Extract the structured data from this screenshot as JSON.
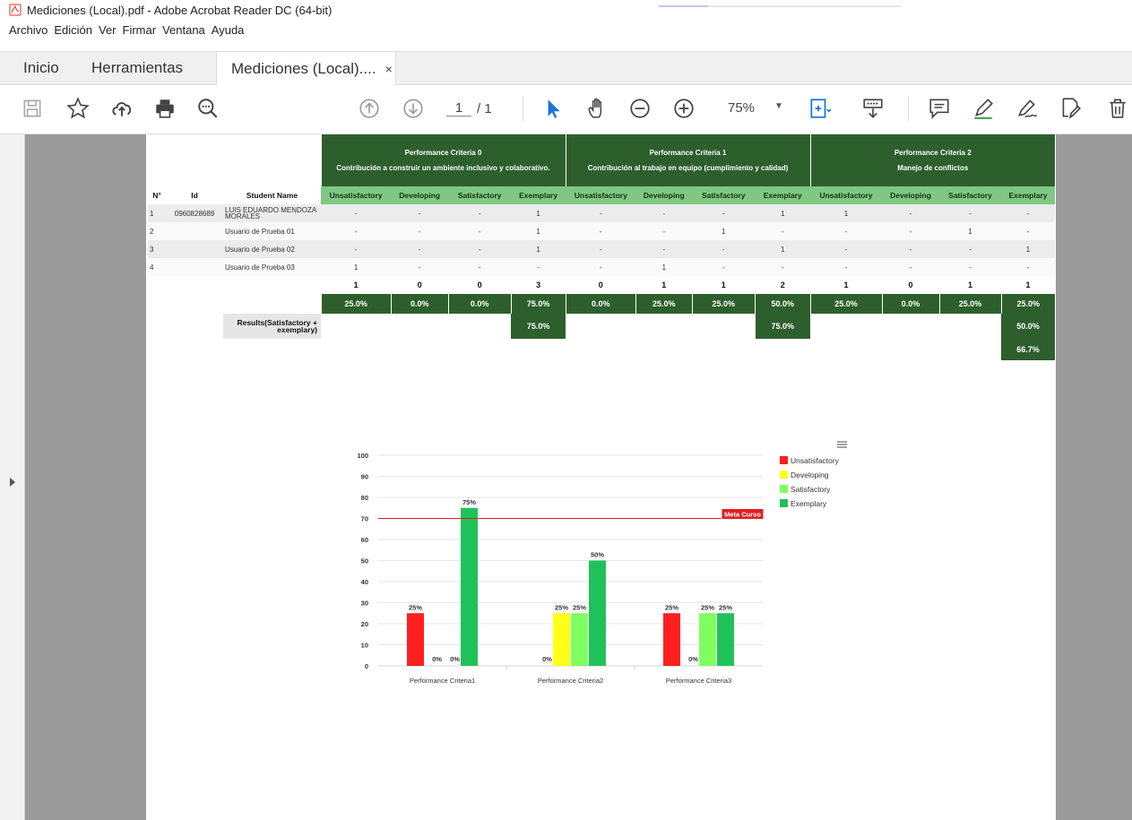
{
  "window": {
    "title": "Mediciones (Local).pdf - Adobe Acrobat Reader DC (64-bit)"
  },
  "menu": [
    "Archivo",
    "Edición",
    "Ver",
    "Firmar",
    "Ventana",
    "Ayuda"
  ],
  "tabs": {
    "home": "Inicio",
    "tools": "Herramientas",
    "doc": "Mediciones (Local)....",
    "close": "×"
  },
  "toolbar": {
    "page_current": "1",
    "page_total": "/ 1",
    "zoom": "75%"
  },
  "table": {
    "criteria": [
      {
        "name": "Performance Criteria 0",
        "desc": "Contribución a construir un ambiente inclusivo y colaborativo."
      },
      {
        "name": "Performance Criteria 1",
        "desc": "Contribución al trabajo en equipo (cumplimiento y calidad)"
      },
      {
        "name": "Performance Criteria 2",
        "desc": "Manejo de conflictos"
      }
    ],
    "headers": {
      "num": "N°",
      "id": "Id",
      "name": "Student Name"
    },
    "levels": [
      "Unsatisfactory",
      "Developing",
      "Satisfactory",
      "Exemplary"
    ],
    "rows": [
      {
        "num": "1",
        "id": "0960828689",
        "name": "LUIS EDUARDO MENDOZA MORALES",
        "values": [
          "-",
          "-",
          "-",
          "1",
          "-",
          "-",
          "-",
          "1",
          "1",
          "-",
          "-",
          "-"
        ]
      },
      {
        "num": "2",
        "id": "",
        "name": "Usuario de Prueba 01",
        "values": [
          "-",
          "-",
          "-",
          "1",
          "-",
          "-",
          "1",
          "-",
          "-",
          "-",
          "1",
          "-"
        ]
      },
      {
        "num": "3",
        "id": "",
        "name": "Usuario de Prueba 02",
        "values": [
          "-",
          "-",
          "-",
          "1",
          "-",
          "-",
          "-",
          "1",
          "-",
          "-",
          "-",
          "1"
        ]
      },
      {
        "num": "4",
        "id": "",
        "name": "Usuario de Prueba 03",
        "values": [
          "1",
          "-",
          "-",
          "-",
          "-",
          "1",
          "-",
          "-",
          "-",
          "-",
          "-",
          "-"
        ]
      }
    ],
    "totals": [
      "1",
      "0",
      "0",
      "3",
      "0",
      "1",
      "1",
      "2",
      "1",
      "0",
      "1",
      "1"
    ],
    "percentages": [
      "25.0%",
      "0.0%",
      "0.0%",
      "75.0%",
      "0.0%",
      "25.0%",
      "25.0%",
      "50.0%",
      "25.0%",
      "0.0%",
      "25.0%",
      "25.0%"
    ],
    "results_label": "Results(Satisfactory + exemplary)",
    "results": [
      "75.0%",
      "75.0%",
      "50.0%"
    ],
    "overall": "66.7%"
  },
  "chart_data": {
    "type": "bar",
    "categories": [
      "Performance Criteria1",
      "Performance Criteria2",
      "Performance Criteria3"
    ],
    "series": [
      {
        "name": "Unsatisfactory",
        "color": "#ff1f1f",
        "values": [
          25,
          0,
          25
        ]
      },
      {
        "name": "Developing",
        "color": "#ffff1a",
        "values": [
          0,
          25,
          0
        ]
      },
      {
        "name": "Satisfactory",
        "color": "#80ff60",
        "values": [
          0,
          25,
          25
        ]
      },
      {
        "name": "Exemplary",
        "color": "#1fc25a",
        "values": [
          75,
          50,
          25
        ]
      }
    ],
    "ylim": [
      0,
      100
    ],
    "yticks": [
      0,
      10,
      20,
      30,
      40,
      50,
      60,
      70,
      80,
      90,
      100
    ],
    "plot_line": {
      "value": 70,
      "label": "Meta Curso",
      "color": "#e02020"
    },
    "legend": "right",
    "grid": true
  }
}
